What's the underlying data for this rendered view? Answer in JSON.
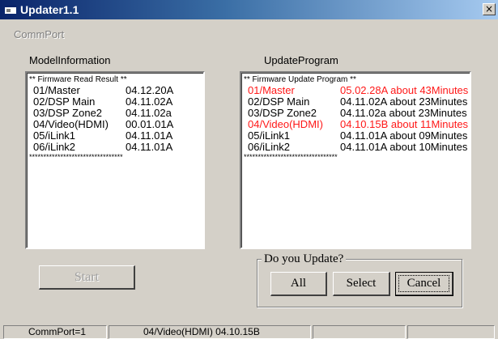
{
  "window": {
    "title": "Updater1.1",
    "close_glyph": "×"
  },
  "menu": {
    "items": [
      {
        "label": "CommPort"
      }
    ]
  },
  "model_info": {
    "label": "ModelInformation",
    "header": "** Firmware Read Result **",
    "rows": [
      {
        "name": "01/Master",
        "version": "04.12.20A"
      },
      {
        "name": "02/DSP Main",
        "version": "04.11.02A"
      },
      {
        "name": "03/DSP Zone2",
        "version": "04.11.02a"
      },
      {
        "name": "04/Video(HDMI)",
        "version": "00.01.01A"
      },
      {
        "name": "05/iLink1",
        "version": "04.11.01A"
      },
      {
        "name": "06/iLink2",
        "version": "04.11.01A"
      }
    ],
    "separator": "*********************************"
  },
  "update_program": {
    "label": "UpdateProgram",
    "header": "** Firmware Update Program **",
    "rows": [
      {
        "name": "01/Master",
        "version": "05.02.28A about 43Minutes",
        "highlight": true
      },
      {
        "name": "02/DSP Main",
        "version": "04.11.02A about 23Minutes",
        "highlight": false
      },
      {
        "name": "03/DSP Zone2",
        "version": "04.11.02a about 23Minutes",
        "highlight": false
      },
      {
        "name": "04/Video(HDMI)",
        "version": "04.10.15B about 11Minutes",
        "highlight": true
      },
      {
        "name": "05/iLink1",
        "version": "04.11.01A about 09Minutes",
        "highlight": false
      },
      {
        "name": "06/iLink2",
        "version": "04.11.01A about 10Minutes",
        "highlight": false
      }
    ],
    "separator": "*********************************"
  },
  "buttons": {
    "start": "Start",
    "all": "All",
    "select": "Select",
    "cancel": "Cancel"
  },
  "update_group": {
    "title": "Do you Update?"
  },
  "status_bar": {
    "cells": [
      "CommPort=1",
      "04/Video(HDMI) 04.10.15B",
      "",
      ""
    ]
  },
  "colors": {
    "highlight": "#ff1818",
    "titlebar_start": "#0a246a",
    "titlebar_end": "#a6caf0",
    "face": "#d4d0c8"
  }
}
